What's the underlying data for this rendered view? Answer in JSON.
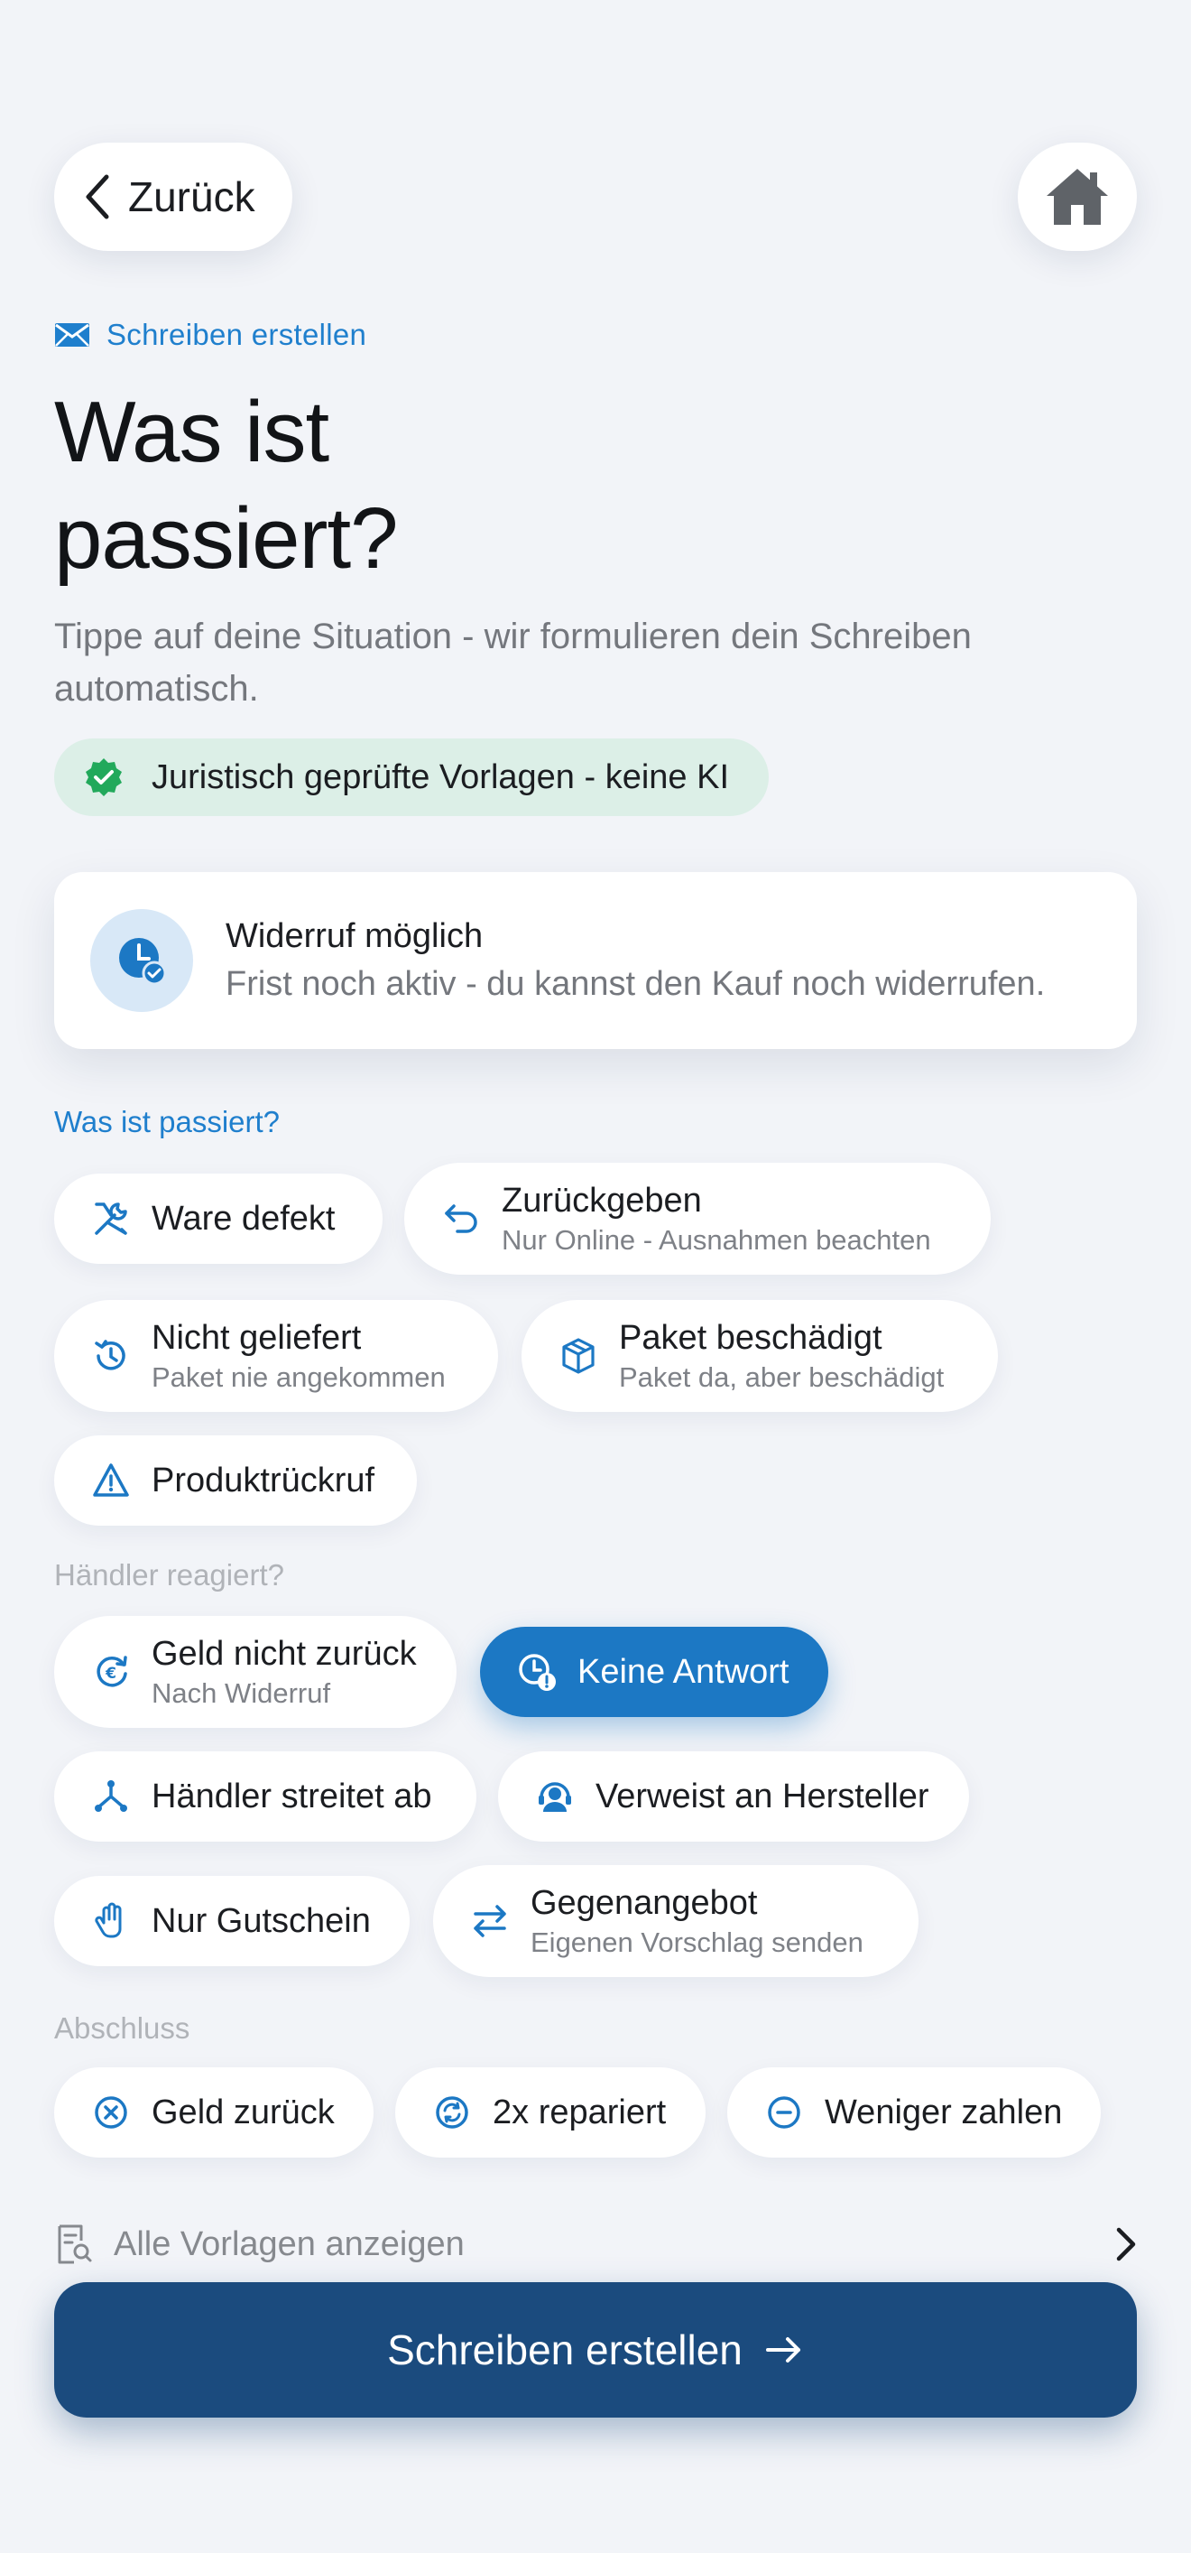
{
  "nav": {
    "back_label": "Zurück"
  },
  "header": {
    "eyebrow": "Schreiben erstellen",
    "title_line1": "Was ist",
    "title_line2": "passiert?",
    "subtitle": "Tippe auf deine Situation - wir formulieren dein Schreiben automatisch.",
    "badge": "Juristisch geprüfte Vorlagen - keine KI"
  },
  "status": {
    "title": "Widerruf möglich",
    "text": "Frist noch aktiv - du kannst den Kauf noch widerrufen."
  },
  "sections": {
    "what": "Was ist passiert?",
    "merchant": "Händler reagiert?",
    "closing": "Abschluss"
  },
  "chips": {
    "defect": {
      "label": "Ware defekt"
    },
    "return": {
      "label": "Zurückgeben",
      "sub": "Nur Online - Ausnahmen beachten"
    },
    "not_delivered": {
      "label": "Nicht geliefert",
      "sub": "Paket nie angekommen"
    },
    "damaged": {
      "label": "Paket beschädigt",
      "sub": "Paket da, aber beschädigt"
    },
    "recall": {
      "label": "Produktrückruf"
    },
    "no_refund": {
      "label": "Geld nicht zurück",
      "sub": "Nach Widerruf"
    },
    "no_answer": {
      "label": "Keine Antwort"
    },
    "denies": {
      "label": "Händler streitet ab"
    },
    "refers": {
      "label": "Verweist an Hersteller"
    },
    "voucher": {
      "label": "Nur Gutschein"
    },
    "counter": {
      "label": "Gegenangebot",
      "sub": "Eigenen Vorschlag senden"
    },
    "refund": {
      "label": "Geld zurück"
    },
    "repaired": {
      "label": "2x repariert"
    },
    "pay_less": {
      "label": "Weniger zahlen"
    }
  },
  "footer": {
    "all_templates": "Alle Vorlagen anzeigen",
    "cta": "Schreiben erstellen"
  },
  "colors": {
    "accent": "#1c78c4",
    "cta": "#1b4b7e",
    "badge_bg": "#dcefe7",
    "badge_icon": "#22a95b",
    "section_label_primary": "#1f7fcd",
    "section_label_muted": "#b0b3b8"
  }
}
